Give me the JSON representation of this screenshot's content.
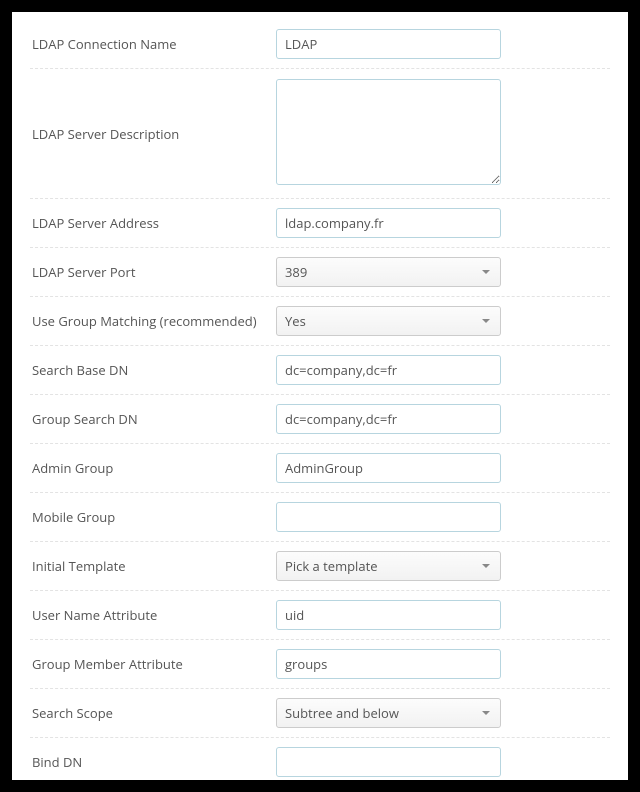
{
  "fields": {
    "connection_name": {
      "label": "LDAP Connection Name",
      "value": "LDAP"
    },
    "server_description": {
      "label": "LDAP Server Description",
      "value": ""
    },
    "server_address": {
      "label": "LDAP Server Address",
      "value": "ldap.company.fr"
    },
    "server_port": {
      "label": "LDAP Server Port",
      "value": "389"
    },
    "use_group_matching": {
      "label": "Use Group Matching (recommended)",
      "value": "Yes"
    },
    "search_base_dn": {
      "label": "Search Base DN",
      "value": "dc=company,dc=fr"
    },
    "group_search_dn": {
      "label": "Group Search DN",
      "value": "dc=company,dc=fr"
    },
    "admin_group": {
      "label": "Admin Group",
      "value": "AdminGroup"
    },
    "mobile_group": {
      "label": "Mobile Group",
      "value": ""
    },
    "initial_template": {
      "label": "Initial Template",
      "value": "Pick a template"
    },
    "user_name_attribute": {
      "label": "User Name Attribute",
      "value": "uid"
    },
    "group_member_attribute": {
      "label": "Group Member Attribute",
      "value": "groups"
    },
    "search_scope": {
      "label": "Search Scope",
      "value": "Subtree and below"
    },
    "bind_dn": {
      "label": "Bind DN",
      "value": ""
    }
  }
}
